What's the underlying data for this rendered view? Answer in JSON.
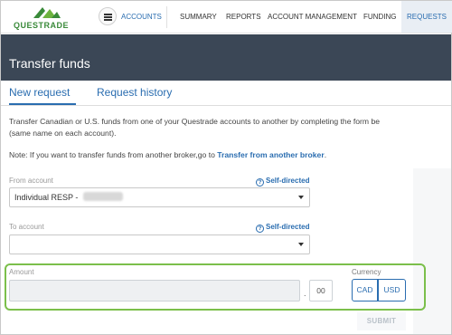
{
  "brand": {
    "name": "QUESTRADE",
    "accent": "#2a6db0",
    "logo_green": "#3a8a3a"
  },
  "nav": {
    "accounts": "ACCOUNTS",
    "summary": "SUMMARY",
    "reports": "REPORTS",
    "account_management": "ACCOUNT MANAGEMENT",
    "funding": "FUNDING",
    "requests": "REQUESTS"
  },
  "page": {
    "title": "Transfer funds"
  },
  "tabs": {
    "new_request": "New request",
    "request_history": "Request history"
  },
  "description": {
    "line1": "Transfer Canadian or U.S. funds from one of your Questrade accounts to another by completing the form be",
    "line2": "(same name on each account)."
  },
  "note": {
    "prefix": "Note: If you want to transfer funds from another broker,go to ",
    "link": "Transfer from another broker",
    "suffix": "."
  },
  "form": {
    "from_account": {
      "label": "From account",
      "help": "Self-directed",
      "value": "Individual RESP - "
    },
    "to_account": {
      "label": "To account",
      "help": "Self-directed",
      "value": ""
    },
    "amount": {
      "label": "Amount",
      "value": "",
      "cents": "00"
    },
    "currency": {
      "label": "Currency",
      "options": [
        "CAD",
        "USD"
      ]
    },
    "submit": "SUBMIT"
  },
  "icons": {
    "menu": "hamburger-icon",
    "help": "question-circle-icon",
    "dropdown": "chevron-down-icon"
  }
}
